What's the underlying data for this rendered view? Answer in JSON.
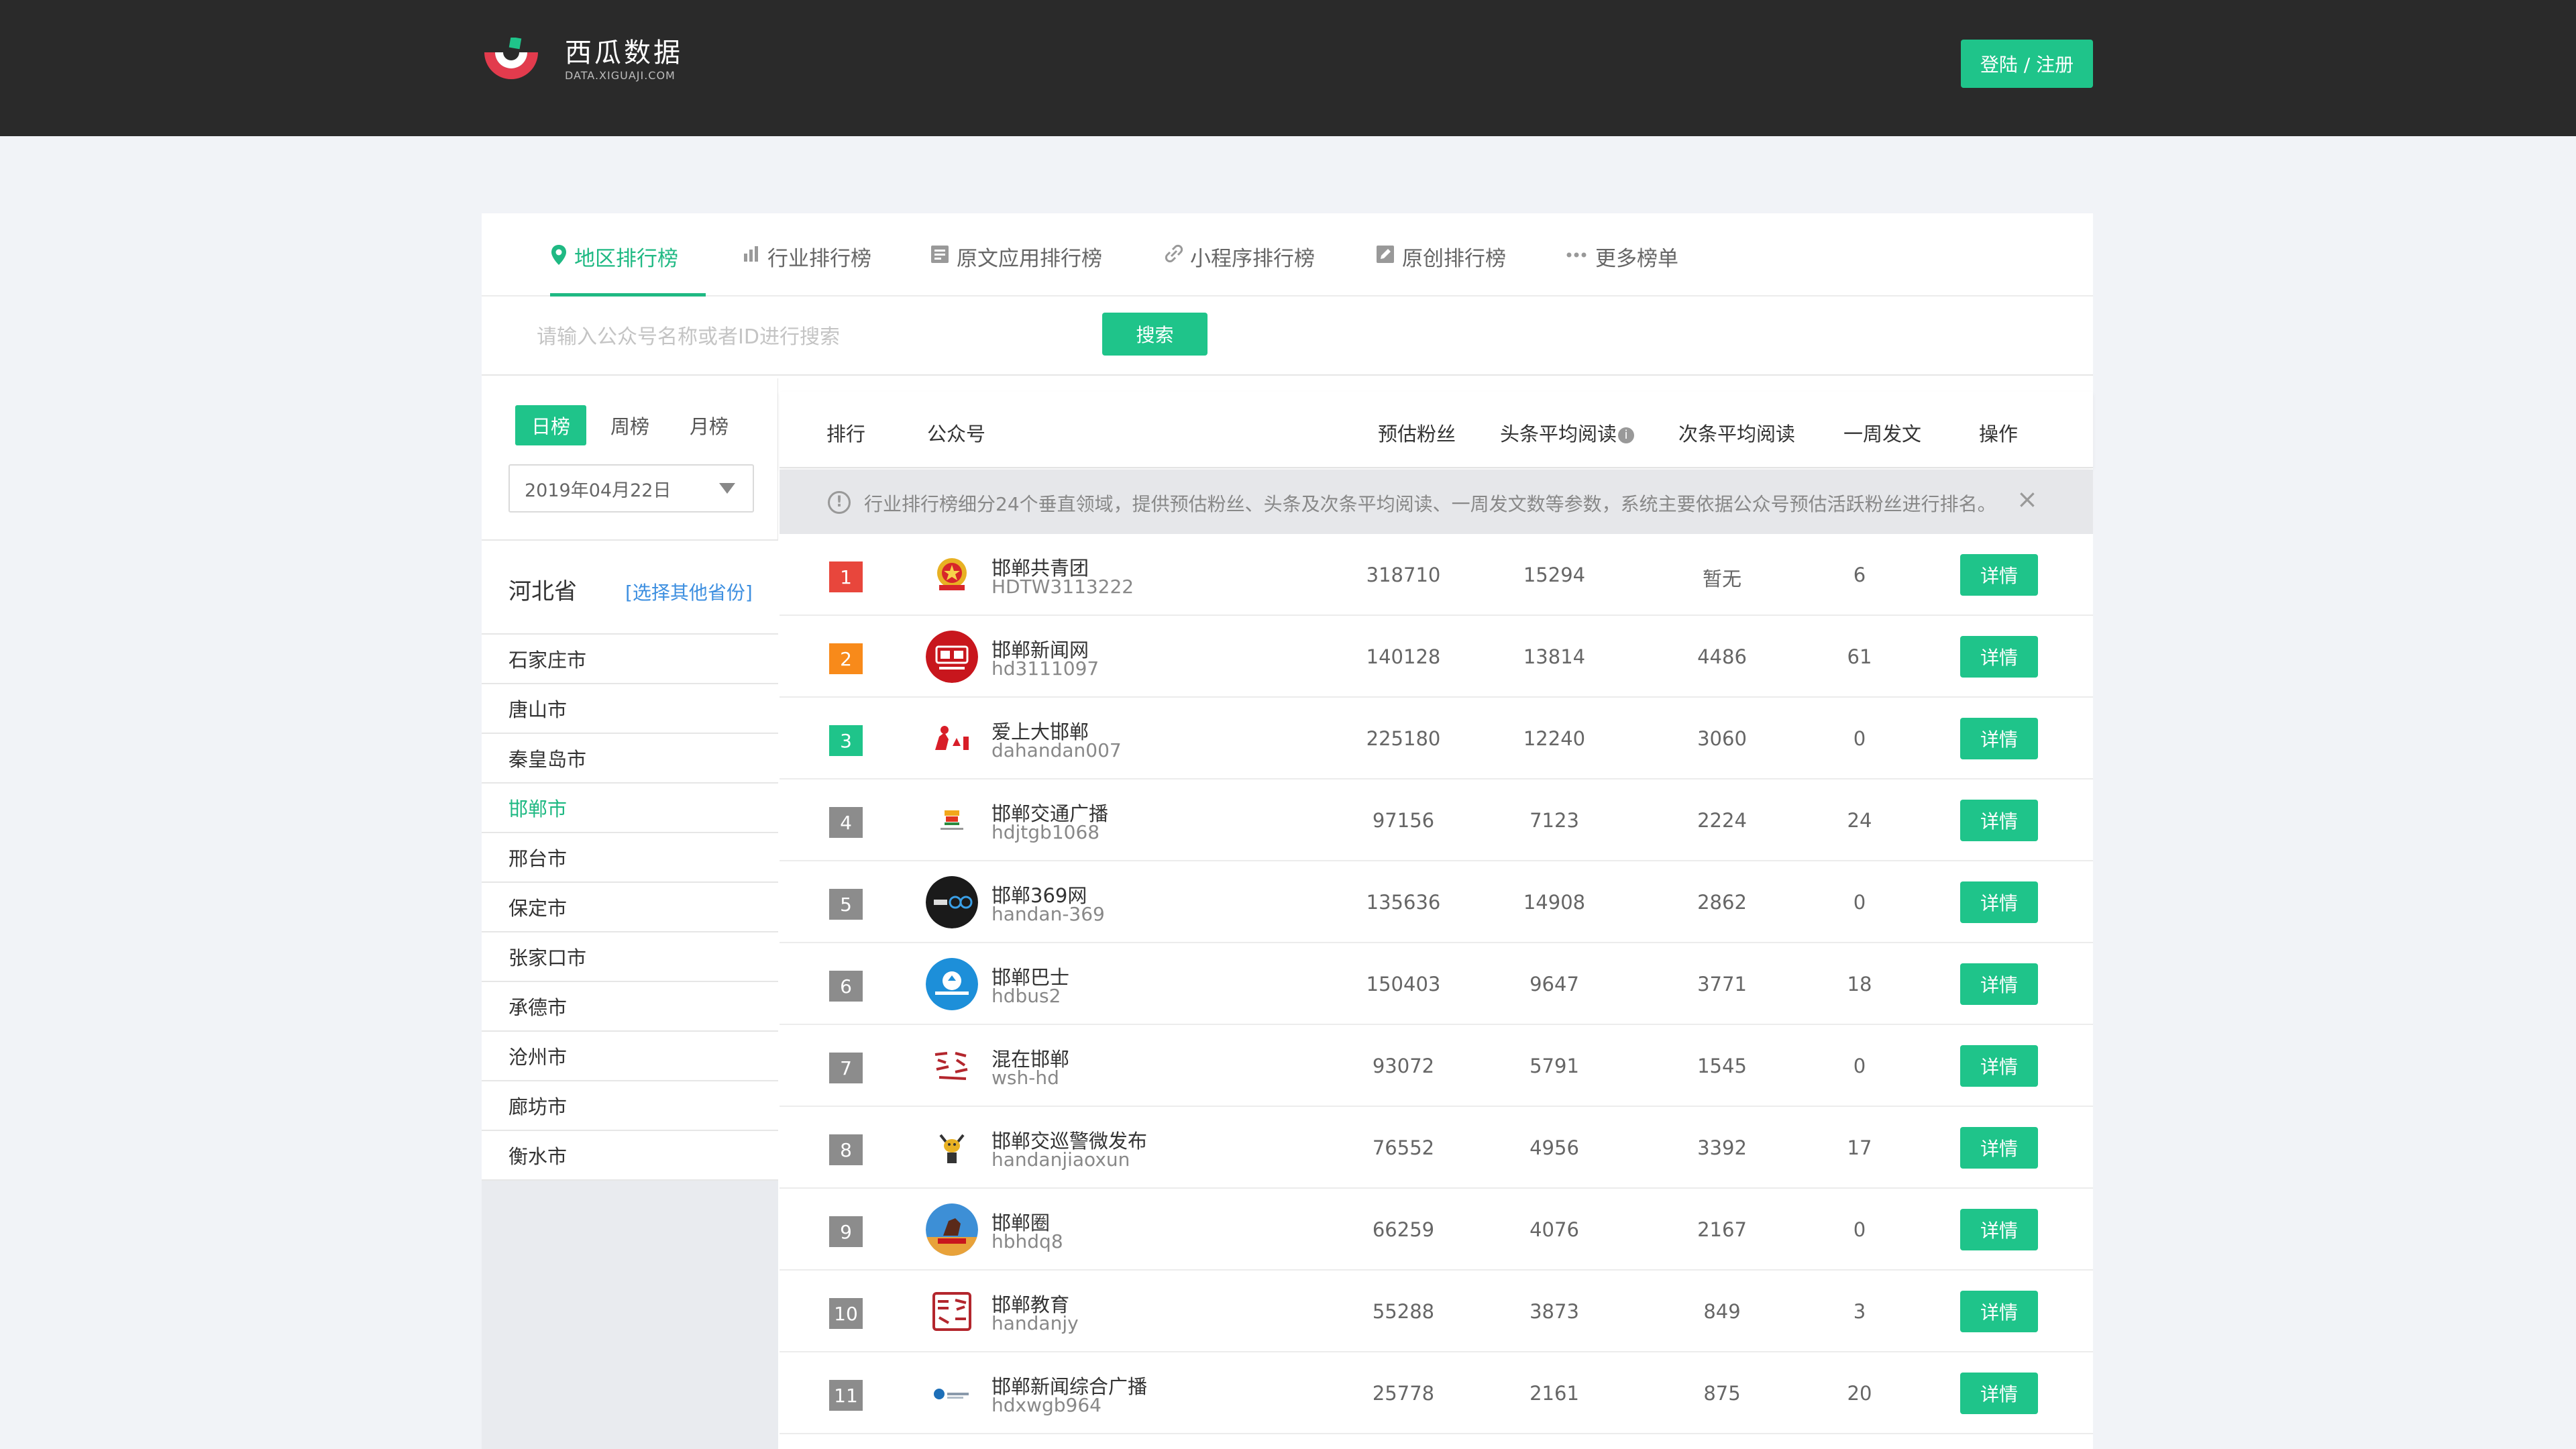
{
  "header": {
    "logo_title": "西瓜数据",
    "logo_sub": "DATA.XIGUAJI.COM",
    "login_label": "登陆 / 注册"
  },
  "tabs": [
    {
      "label": "地区排行榜",
      "icon": "location-pin-icon",
      "active": true
    },
    {
      "label": "行业排行榜",
      "icon": "bar-chart-icon",
      "active": false
    },
    {
      "label": "原文应用排行榜",
      "icon": "document-icon",
      "active": false
    },
    {
      "label": "小程序排行榜",
      "icon": "link-icon",
      "active": false
    },
    {
      "label": "原创排行榜",
      "icon": "edit-icon",
      "active": false
    },
    {
      "label": "更多榜单",
      "icon": "more-dots-icon",
      "active": false
    }
  ],
  "search": {
    "placeholder": "请输入公众号名称或者ID进行搜索",
    "button_label": "搜索"
  },
  "sidebar": {
    "periods": [
      {
        "label": "日榜",
        "active": true
      },
      {
        "label": "周榜",
        "active": false
      },
      {
        "label": "月榜",
        "active": false
      }
    ],
    "date": "2019年04月22日",
    "province": "河北省",
    "change_province": "[选择其他省份]",
    "cities": [
      {
        "label": "石家庄市",
        "active": false
      },
      {
        "label": "唐山市",
        "active": false
      },
      {
        "label": "秦皇岛市",
        "active": false
      },
      {
        "label": "邯郸市",
        "active": true
      },
      {
        "label": "邢台市",
        "active": false
      },
      {
        "label": "保定市",
        "active": false
      },
      {
        "label": "张家口市",
        "active": false
      },
      {
        "label": "承德市",
        "active": false
      },
      {
        "label": "沧州市",
        "active": false
      },
      {
        "label": "廊坊市",
        "active": false
      },
      {
        "label": "衡水市",
        "active": false
      }
    ]
  },
  "table": {
    "columns": {
      "rank": "排行",
      "account": "公众号",
      "fans": "预估粉丝",
      "head_read": "头条平均阅读",
      "second_read": "次条平均阅读",
      "weekly": "一周发文",
      "action": "操作"
    },
    "notice": "行业排行榜细分24个垂直领域，提供预估粉丝、头条及次条平均阅读、一周发文数等参数，系统主要依据公众号预估活跃粉丝进行排名。",
    "detail_label": "详情",
    "rows": [
      {
        "rank": "1",
        "name": "邯郸共青团",
        "id": "HDTW3113222",
        "fans": "318710",
        "head": "15294",
        "second": "暂无",
        "weekly": "6"
      },
      {
        "rank": "2",
        "name": "邯郸新闻网",
        "id": "hd3111097",
        "fans": "140128",
        "head": "13814",
        "second": "4486",
        "weekly": "61"
      },
      {
        "rank": "3",
        "name": "爱上大邯郸",
        "id": "dahandan007",
        "fans": "225180",
        "head": "12240",
        "second": "3060",
        "weekly": "0"
      },
      {
        "rank": "4",
        "name": "邯郸交通广播",
        "id": "hdjtgb1068",
        "fans": "97156",
        "head": "7123",
        "second": "2224",
        "weekly": "24"
      },
      {
        "rank": "5",
        "name": "邯郸369网",
        "id": "handan-369",
        "fans": "135636",
        "head": "14908",
        "second": "2862",
        "weekly": "0"
      },
      {
        "rank": "6",
        "name": "邯郸巴士",
        "id": "hdbus2",
        "fans": "150403",
        "head": "9647",
        "second": "3771",
        "weekly": "18"
      },
      {
        "rank": "7",
        "name": "混在邯郸",
        "id": "wsh-hd",
        "fans": "93072",
        "head": "5791",
        "second": "1545",
        "weekly": "0"
      },
      {
        "rank": "8",
        "name": "邯郸交巡警微发布",
        "id": "handanjiaoxun",
        "fans": "76552",
        "head": "4956",
        "second": "3392",
        "weekly": "17"
      },
      {
        "rank": "9",
        "name": "邯郸圈",
        "id": "hbhdq8",
        "fans": "66259",
        "head": "4076",
        "second": "2167",
        "weekly": "0"
      },
      {
        "rank": "10",
        "name": "邯郸教育",
        "id": "handanjy",
        "fans": "55288",
        "head": "3873",
        "second": "849",
        "weekly": "3"
      },
      {
        "rank": "11",
        "name": "邯郸新闻综合广播",
        "id": "hdxwgb964",
        "fans": "25778",
        "head": "2161",
        "second": "875",
        "weekly": "20"
      }
    ]
  },
  "colors": {
    "accent": "#1fc48a",
    "header_bg": "#2a2a2a",
    "rank1": "#e8463c",
    "rank2": "#f88a1a",
    "rank3": "#1fc48a",
    "rank_default": "#8c8c8c"
  }
}
